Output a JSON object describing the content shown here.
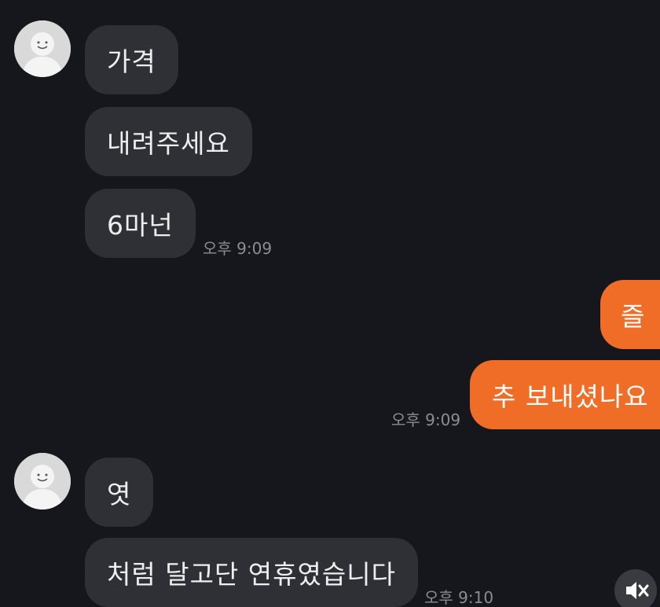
{
  "colors": {
    "background": "#16171c",
    "incoming_bubble": "#2f3035",
    "outgoing_bubble": "#f06d28",
    "timestamp": "#8c8c92"
  },
  "messages": {
    "group1": {
      "avatar_icon": "default-profile-icon",
      "m1": "가격",
      "m2": "내려주세요",
      "m3": "6마넌",
      "time": "오후 9:09"
    },
    "group2": {
      "m1": "즐",
      "m2": "추 보내셨나요",
      "time": "오후 9:09"
    },
    "group3": {
      "avatar_icon": "default-profile-icon",
      "m1": "엿",
      "m2": "처럼 달고단 연휴였습니다",
      "time": "오후 9:10"
    }
  },
  "controls": {
    "mute_icon": "speaker-muted-icon"
  }
}
